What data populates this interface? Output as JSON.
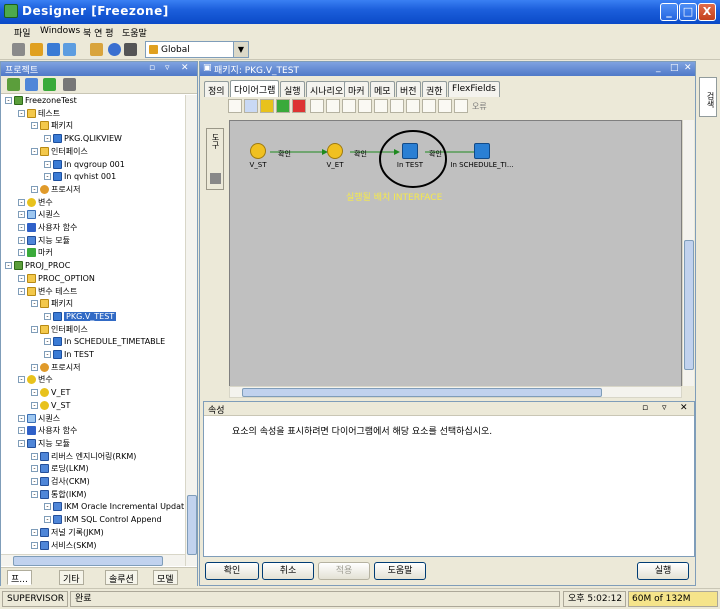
{
  "window": {
    "title": "Designer [Freezone]",
    "min_label": "_",
    "max_label": "□",
    "close_label": "X"
  },
  "menu": [
    "파일",
    "Windows",
    "북 연 평",
    "도움말"
  ],
  "toolbar": {
    "context": "Global",
    "context_dropdown": "▼"
  },
  "left_panel": {
    "title": "프로젝트",
    "tree": [
      {
        "label": "FreezoneTest",
        "icon": "project-icon",
        "indent": 0
      },
      {
        "label": "테스트",
        "icon": "folder-icon",
        "indent": 1
      },
      {
        "label": "패키지",
        "icon": "folder-icon",
        "indent": 2
      },
      {
        "label": "PKG.QLIKVIEW",
        "icon": "package-icon",
        "indent": 3
      },
      {
        "label": "인터페이스",
        "icon": "folder-icon",
        "indent": 2
      },
      {
        "label": "In qvgroup 001",
        "icon": "interface-icon",
        "indent": 3
      },
      {
        "label": "In qvhist 001",
        "icon": "interface-icon",
        "indent": 3
      },
      {
        "label": "프로시저",
        "icon": "procedure-icon",
        "indent": 2
      },
      {
        "label": "변수",
        "icon": "variable-icon",
        "indent": 1
      },
      {
        "label": "시퀀스",
        "icon": "sequence-icon",
        "indent": 1
      },
      {
        "label": "사용자 함수",
        "icon": "function-icon",
        "indent": 1
      },
      {
        "label": "지능 모듈",
        "icon": "km-icon",
        "indent": 1
      },
      {
        "label": "마커",
        "icon": "marker-icon",
        "indent": 1
      },
      {
        "label": "PROJ_PROC",
        "icon": "project-icon",
        "indent": 0
      },
      {
        "label": "PROC_OPTION",
        "icon": "folder-icon",
        "indent": 1
      },
      {
        "label": "변수 테스트",
        "icon": "folder-icon",
        "indent": 1
      },
      {
        "label": "패키지",
        "icon": "folder-icon",
        "indent": 2
      },
      {
        "label": "PKG.V_TEST",
        "icon": "package-icon",
        "indent": 3,
        "selected": true
      },
      {
        "label": "인터페이스",
        "icon": "folder-icon",
        "indent": 2
      },
      {
        "label": "In SCHEDULE_TIMETABLE",
        "icon": "interface-icon",
        "indent": 3
      },
      {
        "label": "In TEST",
        "icon": "interface-icon",
        "indent": 3
      },
      {
        "label": "프로시저",
        "icon": "procedure-icon",
        "indent": 2
      },
      {
        "label": "변수",
        "icon": "variable-icon",
        "indent": 1
      },
      {
        "label": "V_ET",
        "icon": "variable-icon",
        "indent": 2
      },
      {
        "label": "V_ST",
        "icon": "variable-icon",
        "indent": 2
      },
      {
        "label": "시퀀스",
        "icon": "sequence-icon",
        "indent": 1
      },
      {
        "label": "사용자 함수",
        "icon": "function-icon",
        "indent": 1
      },
      {
        "label": "지능 모듈",
        "icon": "km-icon",
        "indent": 1
      },
      {
        "label": "리버스 엔지니어링(RKM)",
        "icon": "km-icon",
        "indent": 2
      },
      {
        "label": "로딩(LKM)",
        "icon": "km-icon",
        "indent": 2
      },
      {
        "label": "검사(CKM)",
        "icon": "km-icon",
        "indent": 2
      },
      {
        "label": "통합(IKM)",
        "icon": "km-icon",
        "indent": 2
      },
      {
        "label": "IKM Oracle Incremental Updat",
        "icon": "km-icon",
        "indent": 3
      },
      {
        "label": "IKM SQL Control Append",
        "icon": "km-icon",
        "indent": 3
      },
      {
        "label": "저널 기록(JKM)",
        "icon": "km-icon",
        "indent": 2
      },
      {
        "label": "서비스(SKM)",
        "icon": "km-icon",
        "indent": 2
      }
    ],
    "tabs": [
      "프...",
      "기타",
      "솔루션",
      "모델"
    ]
  },
  "editor": {
    "title": "패키지: PKG.V_TEST",
    "tabs": [
      "정의",
      "다이어그램",
      "실행",
      "시나리오",
      "마커",
      "메모",
      "버전",
      "권한",
      "FlexFields"
    ],
    "active_tab": "다이어그램",
    "palette_label": "도구",
    "toolbar_label": "오류",
    "nodes": [
      {
        "label": "V_ST",
        "icon": "variable-step-icon"
      },
      {
        "label": "V_ET",
        "icon": "variable-step-icon"
      },
      {
        "label": "In TEST",
        "icon": "interface-step-icon"
      },
      {
        "label": "In SCHEDULE_TI...",
        "icon": "interface-step-icon"
      }
    ],
    "links": [
      "확인",
      "확인",
      "확인"
    ],
    "annotation": "실행될 배치 INTERFACE",
    "properties": {
      "title": "속성",
      "message": "요소의 속성을 표시하려면 다이어그램에서 해당 요소를 선택하십시오."
    },
    "buttons": {
      "ok": "확인",
      "cancel": "취소",
      "apply": "적용",
      "help": "도움말",
      "execute": "실행"
    }
  },
  "right_strip": {
    "tab": "검색"
  },
  "status": {
    "user": "SUPERVISOR",
    "state": "완료",
    "time": "오후 5:02:12",
    "memory": "60M of 132M"
  }
}
